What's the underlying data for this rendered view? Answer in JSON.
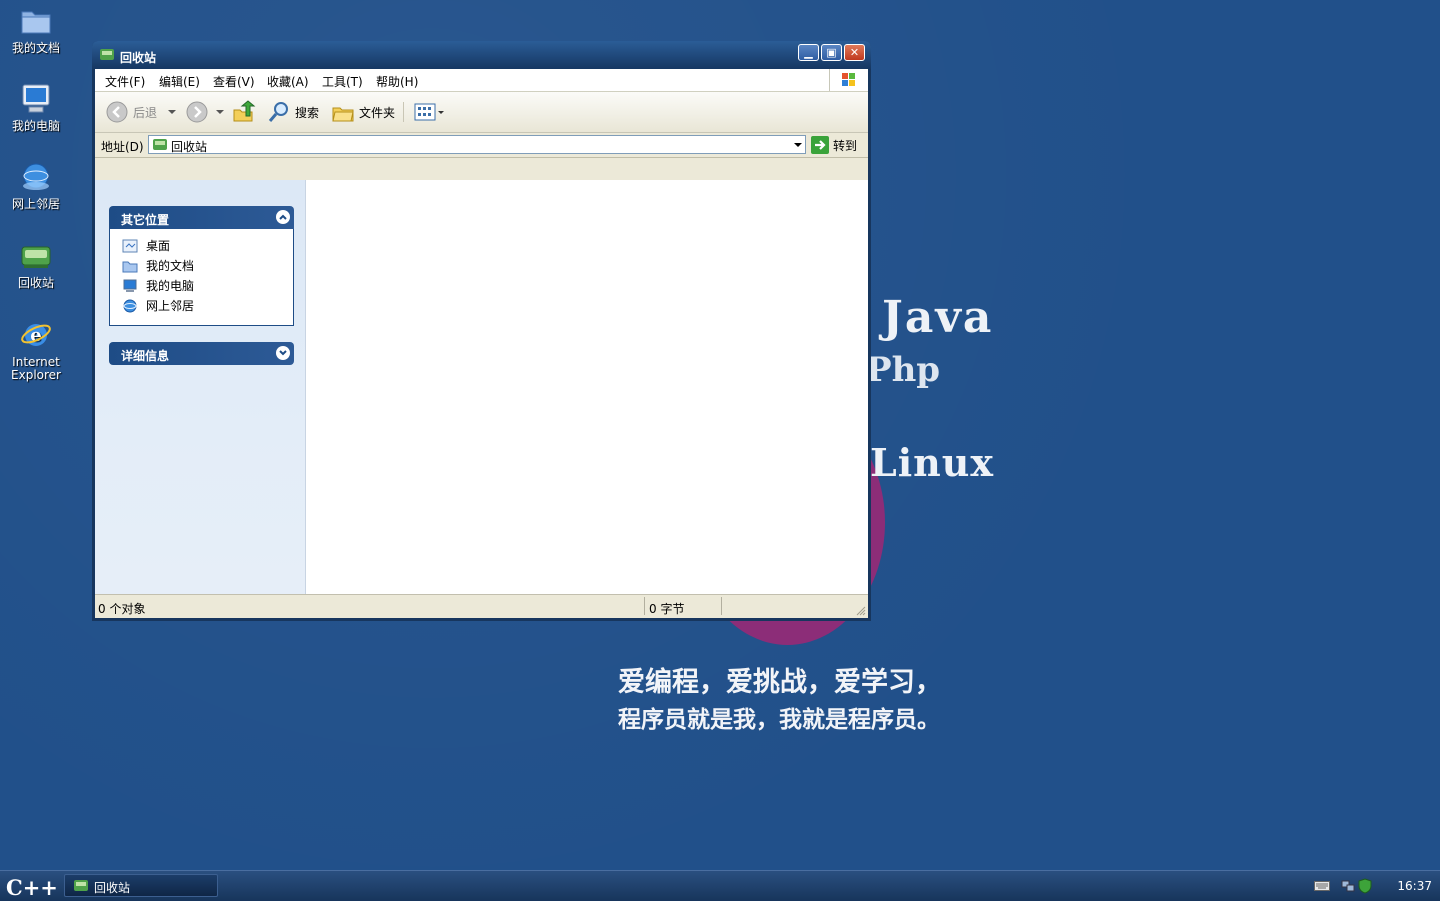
{
  "desktop": {
    "icons": [
      {
        "label": "我的文档"
      },
      {
        "label": "我的电脑"
      },
      {
        "label": "网上邻居"
      },
      {
        "label": "回收站"
      },
      {
        "label_line1": "Internet",
        "label_line2": "Explorer"
      }
    ],
    "wallpaper": {
      "java": "Java",
      "php": "Php",
      "linux": "Linux",
      "slogan_line1": "爱编程，爱挑战，爱学习，",
      "slogan_line2": "程序员就是我，我就是程序员。"
    }
  },
  "window": {
    "title": "回收站",
    "menu": [
      "文件(F)",
      "编辑(E)",
      "查看(V)",
      "收藏(A)",
      "工具(T)",
      "帮助(H)"
    ],
    "toolbar": {
      "back": "后退",
      "search": "搜索",
      "folders": "文件夹"
    },
    "address": {
      "label": "地址(D)",
      "value": "回收站",
      "go": "转到"
    },
    "taskpane": {
      "other_places": {
        "title": "其它位置",
        "items": [
          "桌面",
          "我的文档",
          "我的电脑",
          "网上邻居"
        ]
      },
      "details": {
        "title": "详细信息"
      }
    },
    "status": {
      "objects": "0 个对象",
      "size": "0 字节"
    }
  },
  "taskbar": {
    "start": "C++",
    "task": "回收站",
    "clock": "16:37"
  },
  "colors": {
    "desktop": "#21508a",
    "title_bar": "#163762",
    "pane_header": "#1e4c86",
    "wallpaper_accent": "#8c2d78"
  }
}
